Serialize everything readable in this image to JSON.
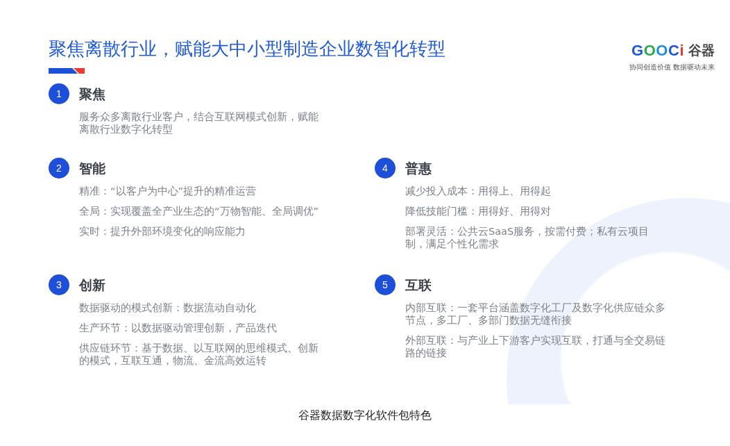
{
  "slide": {
    "title": "聚焦离散行业，赋能大中小型制造企业数智化转型",
    "logo": {
      "mark": "GOOCi",
      "name": "谷器",
      "tagline": "协同创造价值 数据驱动未来"
    },
    "features": [
      {
        "number": "1",
        "title": "聚焦",
        "lines": [
          "服务众多离散行业客户，结合互联网模式创新，赋能离散行业数字化转型"
        ]
      },
      {
        "number": "2",
        "title": "智能",
        "lines": [
          "精准：“以客户为中心”提升的精准运营",
          "全局：实现覆盖全产业生态的“万物智能、全局调优”",
          "实时：提升外部环境变化的响应能力"
        ]
      },
      {
        "number": "3",
        "title": "创新",
        "lines": [
          "数据驱动的模式创新：数据流动自动化",
          "生产环节：以数据驱动管理创新，产品迭代",
          "供应链环节：基于数据、以互联网的思维模式、创新的模式，互联互通，物流、金流高效运转"
        ]
      },
      {
        "number": "4",
        "title": "普惠",
        "lines": [
          "减少投入成本：用得上、用得起",
          "降低技能门槛：用得好、用得对",
          "部署灵活：公共云SaaS服务，按需付费；私有云项目制，满足个性化需求"
        ]
      },
      {
        "number": "5",
        "title": "互联",
        "lines": [
          "内部互联：一套平台涵盖数字化工厂及数字化供应链众多节点，多工厂、多部门数据无缝衔接",
          "外部互联：与产业上下游客户实现互联，打通与全交易链路的链接"
        ]
      }
    ]
  },
  "caption": "谷器数据数字化软件包特色"
}
